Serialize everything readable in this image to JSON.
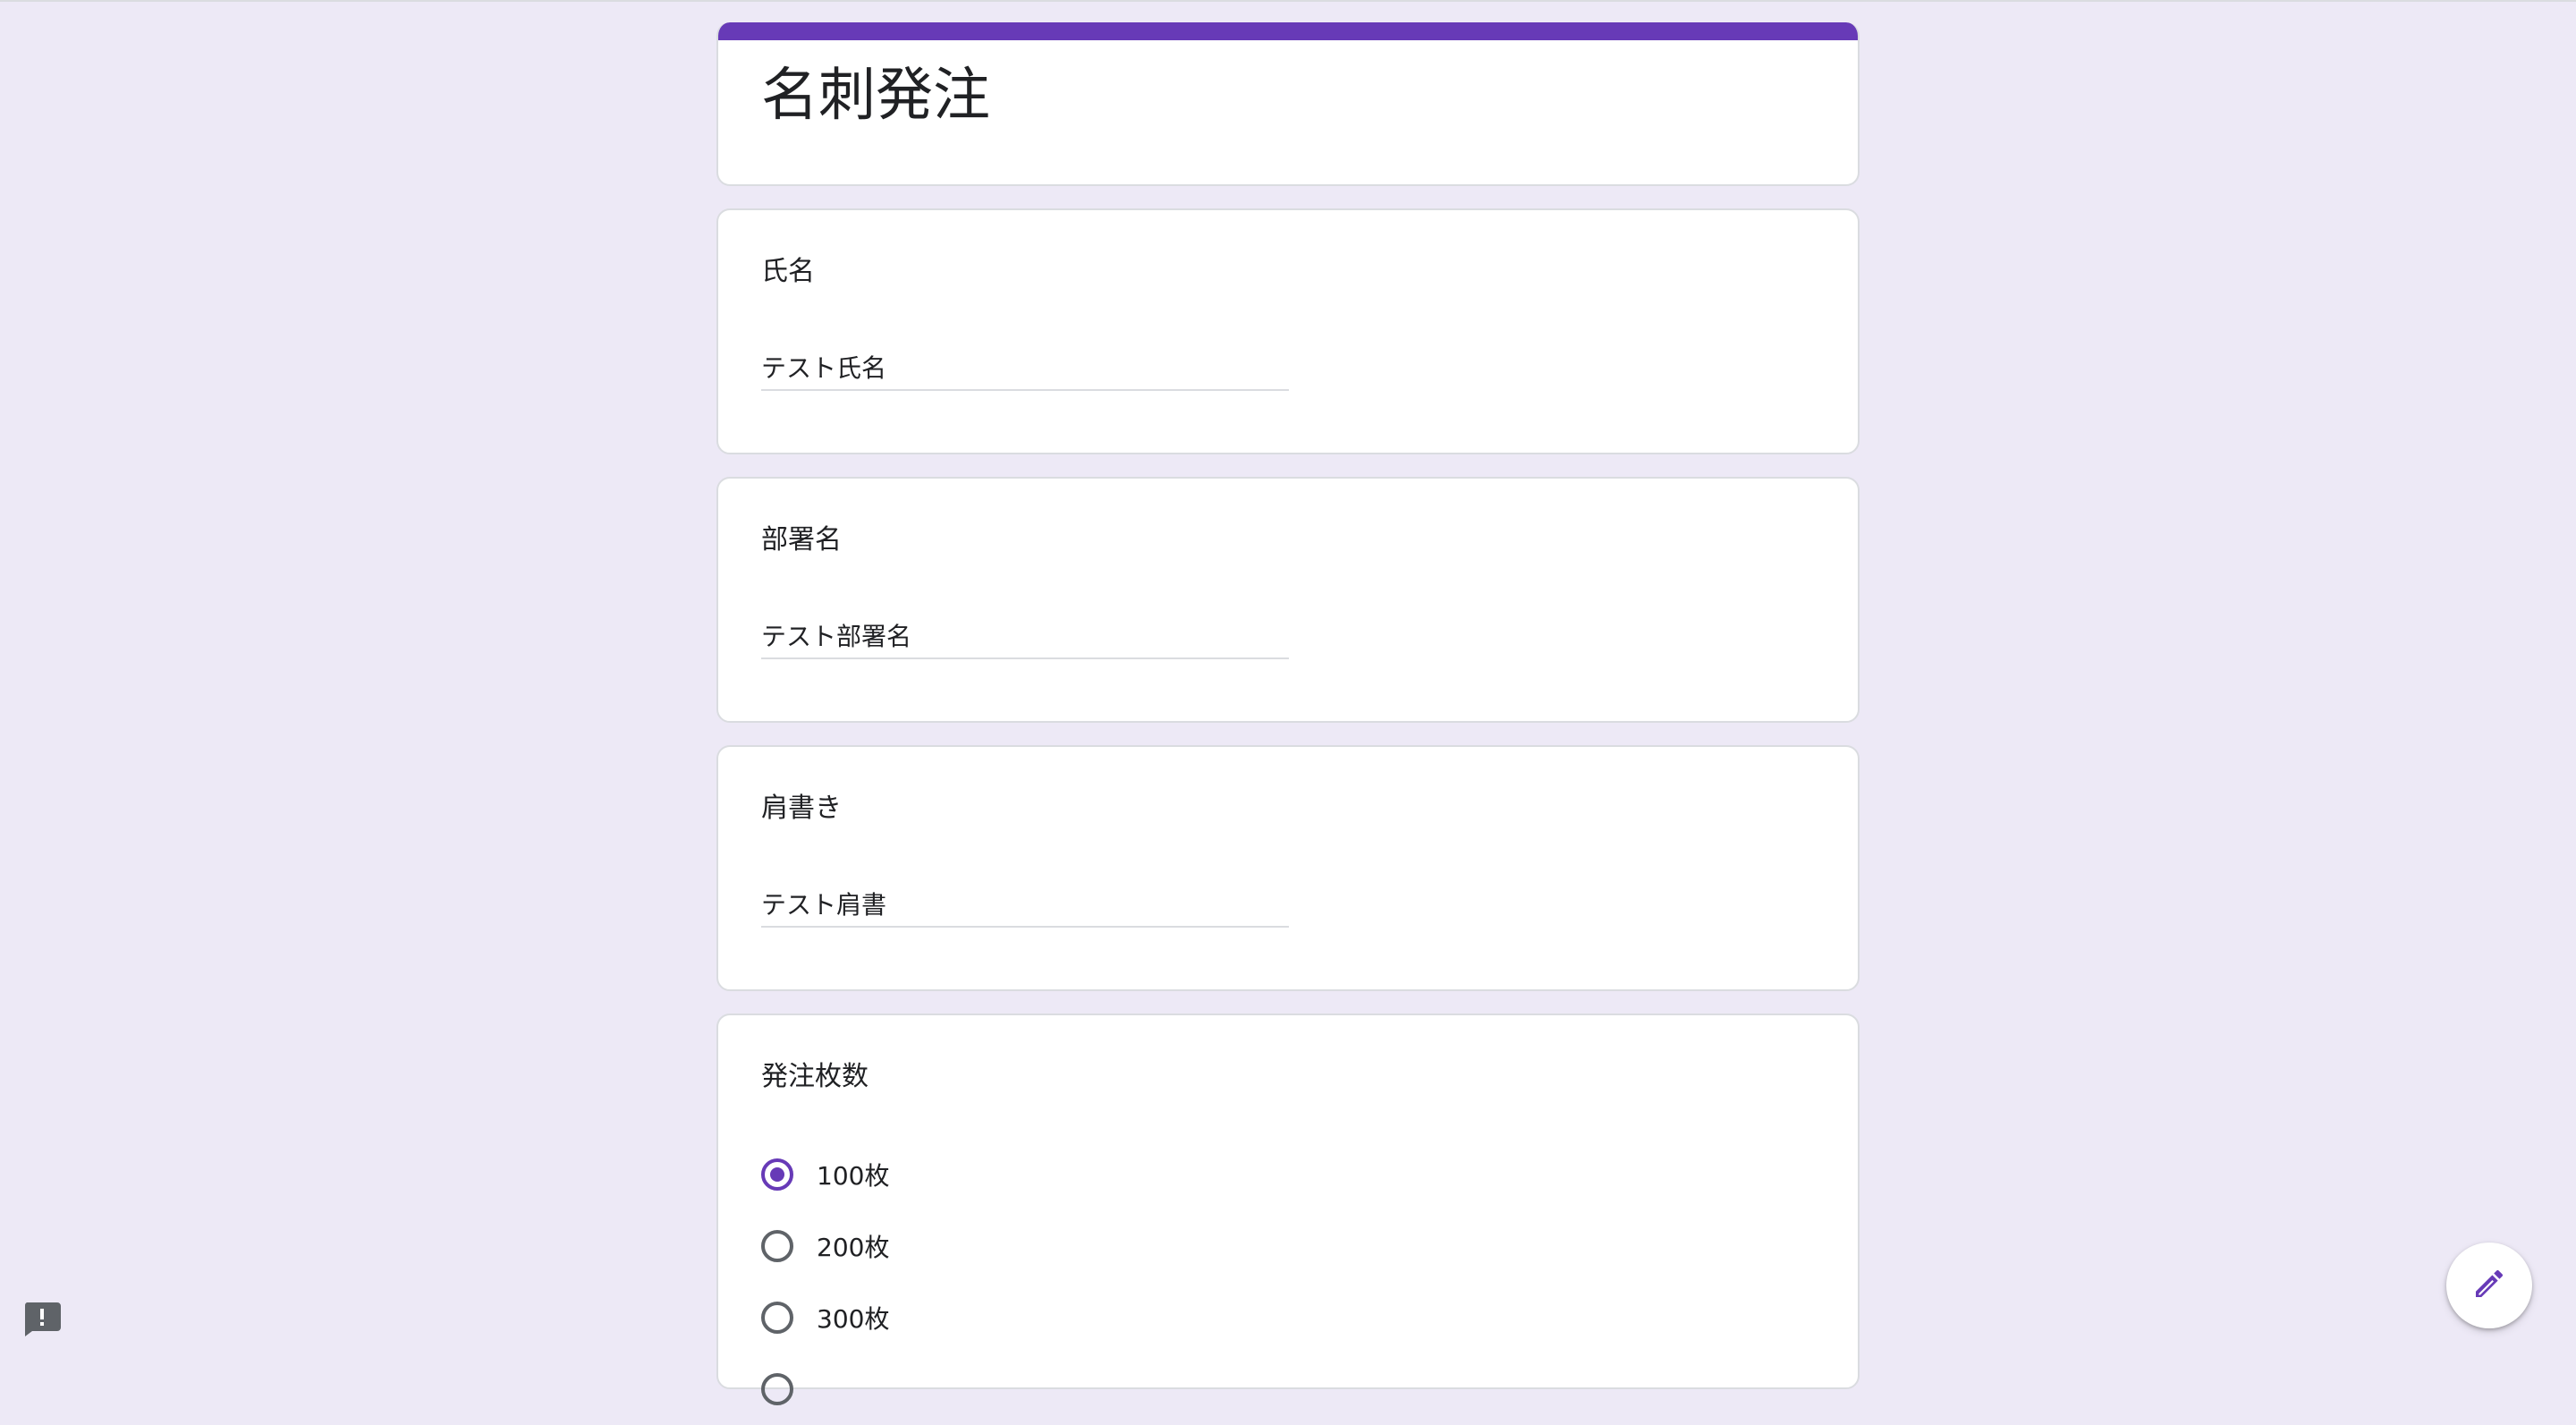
{
  "form": {
    "title": "名刺発注",
    "accent_color": "#673ab7"
  },
  "questions": [
    {
      "title": "氏名",
      "value": "テスト氏名"
    },
    {
      "title": "部署名",
      "value": "テスト部署名"
    },
    {
      "title": "肩書き",
      "value": "テスト肩書"
    }
  ],
  "order_quantity": {
    "title": "発注枚数",
    "options": [
      {
        "label": "100枚",
        "checked": true
      },
      {
        "label": "200枚",
        "checked": false
      },
      {
        "label": "300枚",
        "checked": false
      }
    ]
  },
  "icons": {
    "report": "report-problem-icon",
    "edit": "pencil-edit-icon"
  }
}
